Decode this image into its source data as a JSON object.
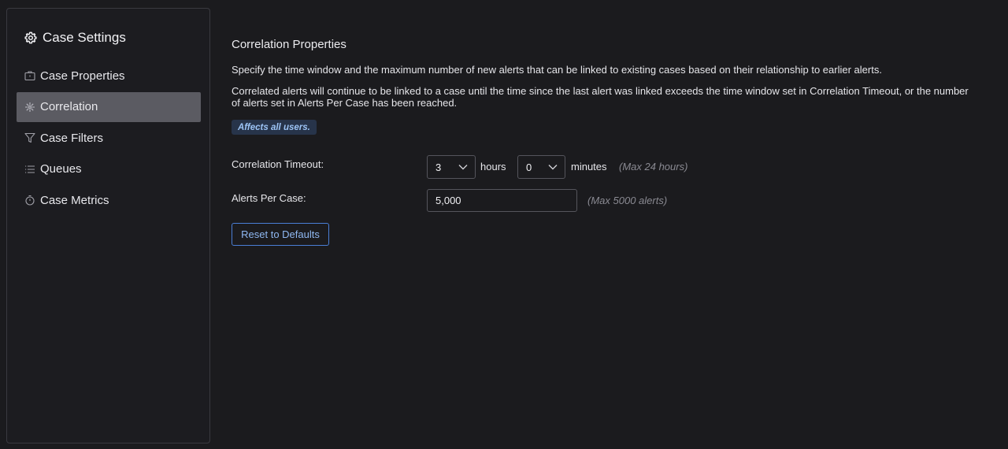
{
  "sidebar": {
    "title": "Case Settings",
    "title_icon": "gear-icon",
    "items": [
      {
        "label": "Case Properties",
        "icon": "briefcase-icon",
        "active": false
      },
      {
        "label": "Correlation",
        "icon": "correlation-icon",
        "active": true
      },
      {
        "label": "Case Filters",
        "icon": "filter-icon",
        "active": false
      },
      {
        "label": "Queues",
        "icon": "list-icon",
        "active": false
      },
      {
        "label": "Case Metrics",
        "icon": "stopwatch-icon",
        "active": false
      }
    ]
  },
  "main": {
    "title": "Correlation Properties",
    "description_1": "Specify the time window and the maximum number of new alerts that can be linked to existing cases based on their relationship to earlier alerts.",
    "description_2": "Correlated alerts will continue to be linked to a case until the time since the last alert was linked exceeds the time window set in Correlation Timeout, or the number of alerts set in Alerts Per Case has been reached.",
    "badge": "Affects all users.",
    "timeout": {
      "label": "Correlation Timeout:",
      "hours_value": "3",
      "hours_unit": "hours",
      "minutes_value": "0",
      "minutes_unit": "minutes",
      "hint": "(Max 24 hours)"
    },
    "alerts_per_case": {
      "label": "Alerts Per Case:",
      "value": "5,000",
      "hint": "(Max 5000 alerts)"
    },
    "reset_button": "Reset to Defaults"
  },
  "colors": {
    "background": "#1b1b1e",
    "active_item": "#5b5b62",
    "accent": "#4a7fd6",
    "badge_bg": "#27344a",
    "badge_text": "#9cc3f4"
  }
}
